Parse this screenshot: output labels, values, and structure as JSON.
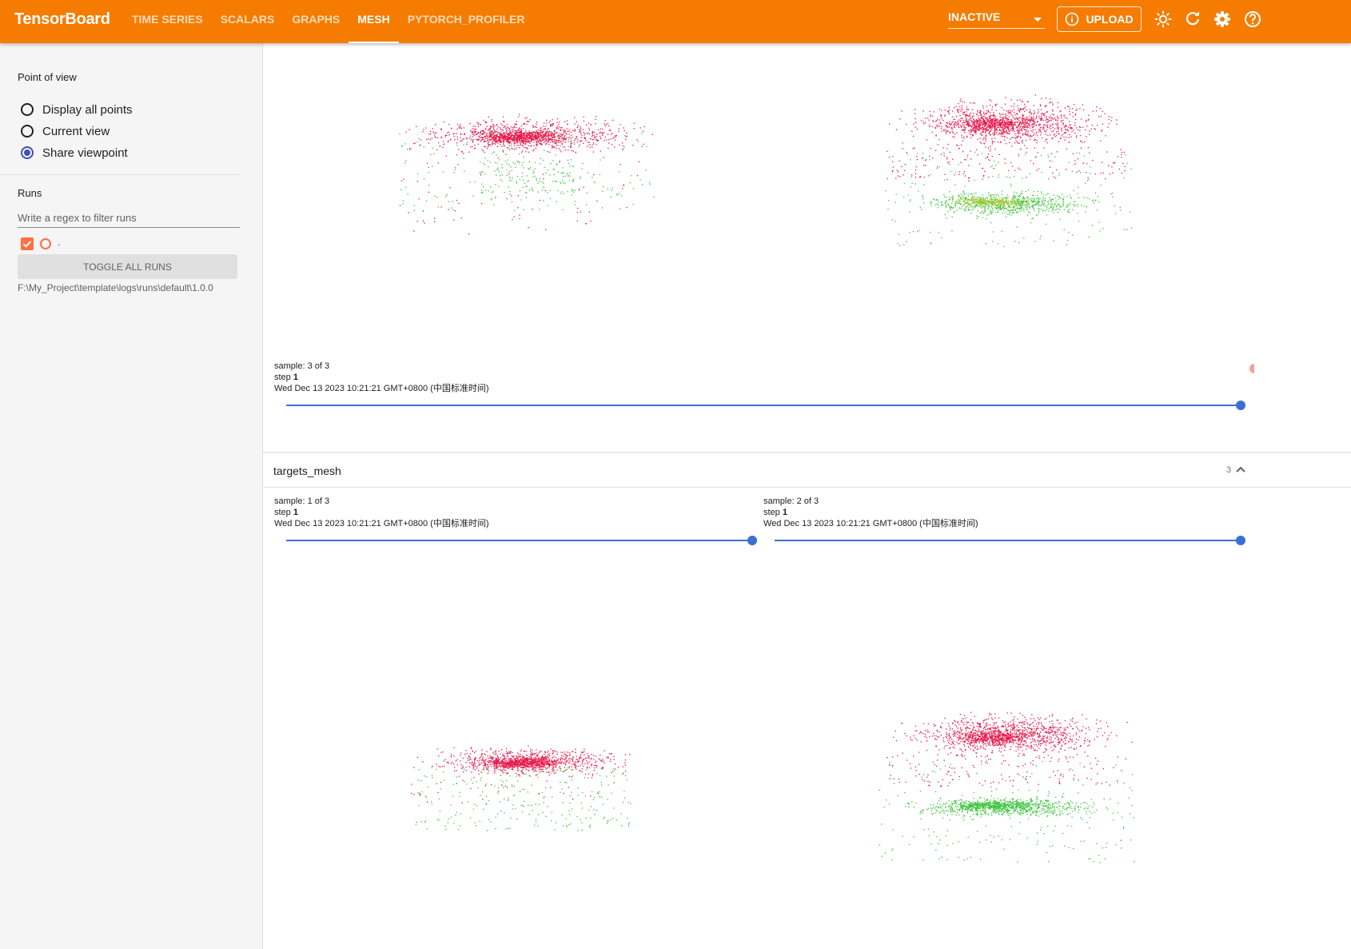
{
  "app": {
    "brand": "TensorBoard",
    "tabs": [
      {
        "label": "TIME SERIES",
        "active": false
      },
      {
        "label": "SCALARS",
        "active": false
      },
      {
        "label": "GRAPHS",
        "active": false
      },
      {
        "label": "MESH",
        "active": true
      },
      {
        "label": "PYTORCH_PROFILER",
        "active": false
      }
    ],
    "run_state": "INACTIVE",
    "upload_label": "UPLOAD",
    "icons": [
      "theme-brightness-icon",
      "refresh-icon",
      "settings-icon",
      "help-icon"
    ],
    "accent_color": "#f57c00"
  },
  "sidebar": {
    "point_of_view_title": "Point of view",
    "pov_options": [
      {
        "label": "Display all points",
        "selected": false
      },
      {
        "label": "Current view",
        "selected": false
      },
      {
        "label": "Share viewpoint",
        "selected": true
      }
    ],
    "runs_title": "Runs",
    "filter_placeholder": "Write a regex to filter runs",
    "run": {
      "name": ".",
      "checked": true,
      "color": "#ff7043"
    },
    "toggle_all_label": "TOGGLE ALL RUNS",
    "run_path": "F:\\My_Project\\template\\logs\\runs\\default\\1.0.0"
  },
  "main": {
    "top_card": {
      "sample": {
        "label": "sample: 3 of 3",
        "step_label": "step",
        "step": "1",
        "time": "Wed Dec 13 2023 10:21:21 GMT+0800 (中国标准时间)",
        "slider_value": 1.0
      }
    },
    "targets_card": {
      "title": "targets_mesh",
      "count": "3",
      "samples": [
        {
          "label": "sample: 1 of 3",
          "step_label": "step",
          "step": "1",
          "time": "Wed Dec 13 2023 10:21:21 GMT+0800 (中国标准时间)",
          "slider_value": 1.0
        },
        {
          "label": "sample: 2 of 3",
          "step_label": "step",
          "step": "1",
          "time": "Wed Dec 13 2023 10:21:21 GMT+0800 (中国标准时间)",
          "slider_value": 1.0
        }
      ]
    },
    "point_colors": {
      "primary": "#e8174b",
      "secondary": "#3cc43c"
    }
  }
}
